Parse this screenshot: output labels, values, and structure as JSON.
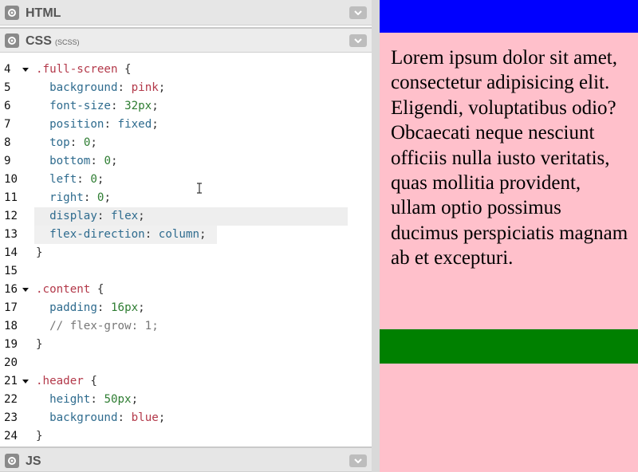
{
  "editor": {
    "panels": {
      "html": {
        "title": "HTML"
      },
      "css": {
        "title": "CSS",
        "subtitle": "(SCSS)"
      },
      "js": {
        "title": "JS"
      }
    },
    "code_lines": [
      {
        "num": "4",
        "fold": true,
        "tokens": [
          {
            "t": ".full-screen",
            "c": "sel"
          },
          {
            "t": " {",
            "c": "pun"
          }
        ]
      },
      {
        "num": "5",
        "tokens": [
          {
            "t": "  "
          },
          {
            "t": "background",
            "c": "prop"
          },
          {
            "t": ": ",
            "c": "pun"
          },
          {
            "t": "pink",
            "c": "val"
          },
          {
            "t": ";",
            "c": "pun"
          }
        ]
      },
      {
        "num": "6",
        "tokens": [
          {
            "t": "  "
          },
          {
            "t": "font-size",
            "c": "prop"
          },
          {
            "t": ": ",
            "c": "pun"
          },
          {
            "t": "32px",
            "c": "num"
          },
          {
            "t": ";",
            "c": "pun"
          }
        ]
      },
      {
        "num": "7",
        "tokens": [
          {
            "t": "  "
          },
          {
            "t": "position",
            "c": "prop"
          },
          {
            "t": ": ",
            "c": "pun"
          },
          {
            "t": "fixed",
            "c": "prop"
          },
          {
            "t": ";",
            "c": "pun"
          }
        ]
      },
      {
        "num": "8",
        "tokens": [
          {
            "t": "  "
          },
          {
            "t": "top",
            "c": "prop"
          },
          {
            "t": ": ",
            "c": "pun"
          },
          {
            "t": "0",
            "c": "num"
          },
          {
            "t": ";",
            "c": "pun"
          }
        ]
      },
      {
        "num": "9",
        "tokens": [
          {
            "t": "  "
          },
          {
            "t": "bottom",
            "c": "prop"
          },
          {
            "t": ": ",
            "c": "pun"
          },
          {
            "t": "0",
            "c": "num"
          },
          {
            "t": ";",
            "c": "pun"
          }
        ]
      },
      {
        "num": "10",
        "tokens": [
          {
            "t": "  "
          },
          {
            "t": "left",
            "c": "prop"
          },
          {
            "t": ": ",
            "c": "pun"
          },
          {
            "t": "0",
            "c": "num"
          },
          {
            "t": ";",
            "c": "pun"
          }
        ]
      },
      {
        "num": "11",
        "tokens": [
          {
            "t": "  "
          },
          {
            "t": "right",
            "c": "prop"
          },
          {
            "t": ": ",
            "c": "pun"
          },
          {
            "t": "0",
            "c": "num"
          },
          {
            "t": ";",
            "c": "pun"
          }
        ]
      },
      {
        "num": "12",
        "highlight": true,
        "tokens": [
          {
            "t": "  "
          },
          {
            "t": "display",
            "c": "prop"
          },
          {
            "t": ": ",
            "c": "pun"
          },
          {
            "t": "flex",
            "c": "prop"
          },
          {
            "t": ";",
            "c": "pun"
          }
        ]
      },
      {
        "num": "13",
        "selected": true,
        "tokens": [
          {
            "t": "  "
          },
          {
            "t": "flex-direction",
            "c": "prop"
          },
          {
            "t": ": ",
            "c": "pun"
          },
          {
            "t": "column",
            "c": "prop"
          },
          {
            "t": ";",
            "c": "pun"
          }
        ]
      },
      {
        "num": "14",
        "tokens": [
          {
            "t": "}",
            "c": "pun"
          }
        ]
      },
      {
        "num": "15",
        "tokens": []
      },
      {
        "num": "16",
        "fold": true,
        "tokens": [
          {
            "t": ".content",
            "c": "sel"
          },
          {
            "t": " {",
            "c": "pun"
          }
        ]
      },
      {
        "num": "17",
        "tokens": [
          {
            "t": "  "
          },
          {
            "t": "padding",
            "c": "prop"
          },
          {
            "t": ": ",
            "c": "pun"
          },
          {
            "t": "16px",
            "c": "num"
          },
          {
            "t": ";",
            "c": "pun"
          }
        ]
      },
      {
        "num": "18",
        "tokens": [
          {
            "t": "  "
          },
          {
            "t": "// flex-grow: 1;",
            "c": "com"
          }
        ]
      },
      {
        "num": "19",
        "tokens": [
          {
            "t": "}",
            "c": "pun"
          }
        ]
      },
      {
        "num": "20",
        "tokens": []
      },
      {
        "num": "21",
        "fold": true,
        "tokens": [
          {
            "t": ".header",
            "c": "sel"
          },
          {
            "t": " {",
            "c": "pun"
          }
        ]
      },
      {
        "num": "22",
        "tokens": [
          {
            "t": "  "
          },
          {
            "t": "height",
            "c": "prop"
          },
          {
            "t": ": ",
            "c": "pun"
          },
          {
            "t": "50px",
            "c": "num"
          },
          {
            "t": ";",
            "c": "pun"
          }
        ]
      },
      {
        "num": "23",
        "tokens": [
          {
            "t": "  "
          },
          {
            "t": "background",
            "c": "prop"
          },
          {
            "t": ": ",
            "c": "pun"
          },
          {
            "t": "blue",
            "c": "val"
          },
          {
            "t": ";",
            "c": "pun"
          }
        ]
      },
      {
        "num": "24",
        "tokens": [
          {
            "t": "}",
            "c": "pun"
          }
        ]
      }
    ]
  },
  "preview": {
    "header_color": "#0000ff",
    "content_bg": "#ffc0cb",
    "footer_color": "#008000",
    "text": "Lorem ipsum dolor sit amet, consectetur adipisicing elit. Eligendi, voluptatibus odio? Obcaecati neque nesciunt officiis nulla iusto veritatis, quas mollitia provident, ullam optio possimus ducimus perspiciatis magnam ab et excepturi."
  },
  "icons": {
    "panel_settings": "gear-icon",
    "panel_collapse": "chevron-down-icon",
    "fold_marker": "caret-down-icon",
    "mouse_cursor": "text-cursor-icon"
  }
}
